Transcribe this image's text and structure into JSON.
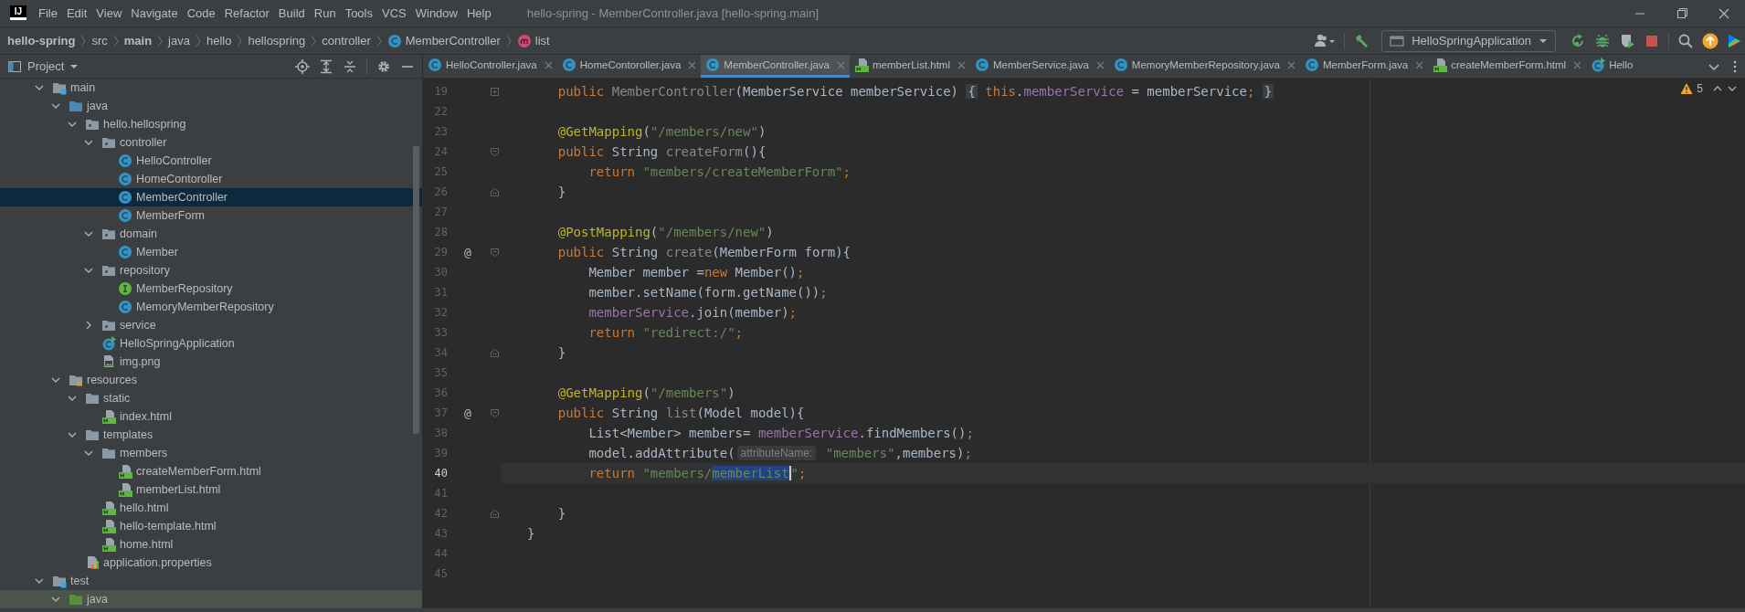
{
  "menu_bar": {
    "logo": "IJ",
    "items": [
      "File",
      "Edit",
      "View",
      "Navigate",
      "Code",
      "Refactor",
      "Build",
      "Run",
      "Tools",
      "VCS",
      "Window",
      "Help"
    ],
    "title": "hello-spring - MemberController.java [hello-spring.main]"
  },
  "navigation_bar": {
    "breadcrumbs": [
      {
        "label": "hello-spring",
        "bold": true
      },
      {
        "label": "src",
        "bold": false
      },
      {
        "label": "main",
        "bold": true
      },
      {
        "label": "java",
        "bold": false
      },
      {
        "label": "hello",
        "bold": false
      },
      {
        "label": "hellospring",
        "bold": false
      },
      {
        "label": "controller",
        "bold": false
      },
      {
        "label": "MemberController",
        "bold": false,
        "kind": "class"
      },
      {
        "label": "list",
        "bold": false,
        "kind": "method"
      }
    ],
    "run_configuration": "HelloSpringApplication"
  },
  "project_panel": {
    "title": "Project",
    "tree": [
      {
        "label": "main",
        "kind": "module",
        "expanded": true,
        "selected": false,
        "hovered": false,
        "children": [
          {
            "label": "java",
            "kind": "source-folder",
            "expanded": true,
            "selected": false,
            "hovered": false,
            "children": [
              {
                "label": "hello.hellospring",
                "kind": "package",
                "expanded": true,
                "selected": false,
                "hovered": false,
                "children": [
                  {
                    "label": "controller",
                    "kind": "package",
                    "expanded": true,
                    "selected": false,
                    "hovered": false,
                    "children": [
                      {
                        "label": "HelloController",
                        "kind": "class",
                        "selected": false,
                        "hovered": false
                      },
                      {
                        "label": "HomeContoroller",
                        "kind": "class",
                        "selected": false,
                        "hovered": false
                      },
                      {
                        "label": "MemberController",
                        "kind": "class",
                        "selected": true,
                        "hovered": false
                      },
                      {
                        "label": "MemberForm",
                        "kind": "class",
                        "selected": false,
                        "hovered": false
                      }
                    ]
                  },
                  {
                    "label": "domain",
                    "kind": "package",
                    "expanded": true,
                    "selected": false,
                    "hovered": false,
                    "children": [
                      {
                        "label": "Member",
                        "kind": "class",
                        "selected": false,
                        "hovered": false
                      }
                    ]
                  },
                  {
                    "label": "repository",
                    "kind": "package",
                    "expanded": true,
                    "selected": false,
                    "hovered": false,
                    "children": [
                      {
                        "label": "MemberRepository",
                        "kind": "interface",
                        "selected": false,
                        "hovered": false
                      },
                      {
                        "label": "MemoryMemberRepository",
                        "kind": "class",
                        "selected": false,
                        "hovered": false
                      }
                    ]
                  },
                  {
                    "label": "service",
                    "kind": "package",
                    "expanded": false,
                    "selected": false,
                    "hovered": false
                  },
                  {
                    "label": "HelloSpringApplication",
                    "kind": "spring-class",
                    "selected": false,
                    "hovered": false
                  },
                  {
                    "label": "img.png",
                    "kind": "image",
                    "selected": false,
                    "hovered": false
                  }
                ]
              }
            ]
          },
          {
            "label": "resources",
            "kind": "resources-folder",
            "expanded": true,
            "selected": false,
            "hovered": false,
            "children": [
              {
                "label": "static",
                "kind": "folder",
                "expanded": true,
                "selected": false,
                "hovered": false,
                "children": [
                  {
                    "label": "index.html",
                    "kind": "html",
                    "selected": false,
                    "hovered": false
                  }
                ]
              },
              {
                "label": "templates",
                "kind": "folder",
                "expanded": true,
                "selected": false,
                "hovered": false,
                "children": [
                  {
                    "label": "members",
                    "kind": "folder",
                    "expanded": true,
                    "selected": false,
                    "hovered": false,
                    "children": [
                      {
                        "label": "createMemberForm.html",
                        "kind": "html",
                        "selected": false,
                        "hovered": false
                      },
                      {
                        "label": "memberList.html",
                        "kind": "html",
                        "selected": false,
                        "hovered": false
                      }
                    ]
                  },
                  {
                    "label": "hello.html",
                    "kind": "html",
                    "selected": false,
                    "hovered": false
                  },
                  {
                    "label": "hello-template.html",
                    "kind": "html",
                    "selected": false,
                    "hovered": false
                  },
                  {
                    "label": "home.html",
                    "kind": "html",
                    "selected": false,
                    "hovered": false
                  }
                ]
              },
              {
                "label": "application.properties",
                "kind": "properties",
                "selected": false,
                "hovered": false
              }
            ]
          }
        ]
      },
      {
        "label": "test",
        "kind": "module",
        "expanded": true,
        "selected": false,
        "hovered": false,
        "children": [
          {
            "label": "java",
            "kind": "test-folder",
            "expanded": true,
            "selected": false,
            "hovered": true
          }
        ]
      }
    ]
  },
  "editor_tabs": [
    {
      "label": "HelloController.java",
      "kind": "class",
      "selected": false,
      "closable": true
    },
    {
      "label": "HomeContoroller.java",
      "kind": "class",
      "selected": false,
      "closable": true
    },
    {
      "label": "MemberController.java",
      "kind": "class",
      "selected": true,
      "closable": true
    },
    {
      "label": "memberList.html",
      "kind": "html",
      "selected": false,
      "closable": true
    },
    {
      "label": "MemberService.java",
      "kind": "class",
      "selected": false,
      "closable": true
    },
    {
      "label": "MemoryMemberRepository.java",
      "kind": "class",
      "selected": false,
      "closable": true
    },
    {
      "label": "MemberForm.java",
      "kind": "class",
      "selected": false,
      "closable": true
    },
    {
      "label": "createMemberForm.html",
      "kind": "html",
      "selected": false,
      "closable": true
    },
    {
      "label": "Hello",
      "kind": "spring-class",
      "selected": false,
      "closable": false
    }
  ],
  "editor": {
    "inspection_count": "5",
    "lines": [
      {
        "number": "19",
        "current": false,
        "kind": "folded",
        "tokens": [
          {
            "text": "    public ",
            "kind": "keyword"
          },
          {
            "text": "MemberController",
            "kind": "unused"
          },
          {
            "text": "(MemberService memberService) ",
            "kind": "plain"
          },
          {
            "text": "{",
            "kind": "folded"
          },
          {
            "text": " this",
            "kind": "keyword"
          },
          {
            "text": ".",
            "kind": "plain"
          },
          {
            "text": "memberService",
            "kind": "field"
          },
          {
            "text": " = memberService",
            "kind": "plain"
          },
          {
            "text": "; ",
            "kind": "keyword"
          },
          {
            "text": "}",
            "kind": "folded"
          }
        ]
      },
      {
        "number": "22",
        "current": false,
        "kind": "plain"
      },
      {
        "number": "23",
        "current": false,
        "kind": "plain",
        "tokens": [
          {
            "text": "    @GetMapping",
            "kind": "annotation"
          },
          {
            "text": "(",
            "kind": "plain"
          },
          {
            "text": "\"/members/new\"",
            "kind": "string"
          },
          {
            "text": ")",
            "kind": "plain"
          }
        ]
      },
      {
        "number": "24",
        "current": false,
        "kind": "fold-start",
        "tokens": [
          {
            "text": "    public",
            "kind": "keyword"
          },
          {
            "text": " String ",
            "kind": "plain"
          },
          {
            "text": "createForm",
            "kind": "unused"
          },
          {
            "text": "(){",
            "kind": "plain"
          }
        ]
      },
      {
        "number": "25",
        "current": false,
        "kind": "plain",
        "tokens": [
          {
            "text": "        return ",
            "kind": "keyword"
          },
          {
            "text": "\"members/createMemberForm\"",
            "kind": "string"
          },
          {
            "text": ";",
            "kind": "keyword"
          }
        ]
      },
      {
        "number": "26",
        "current": false,
        "kind": "fold-end",
        "tokens": [
          {
            "text": "    }",
            "kind": "plain"
          }
        ]
      },
      {
        "number": "27",
        "current": false,
        "kind": "plain"
      },
      {
        "number": "28",
        "current": false,
        "kind": "plain",
        "tokens": [
          {
            "text": "    @PostMapping",
            "kind": "annotation"
          },
          {
            "text": "(",
            "kind": "plain"
          },
          {
            "text": "\"/members/new\"",
            "kind": "string"
          },
          {
            "text": ")",
            "kind": "plain"
          }
        ]
      },
      {
        "number": "29",
        "current": false,
        "gutter_text": "@",
        "kind": "fold-start",
        "tokens": [
          {
            "text": "    public",
            "kind": "keyword"
          },
          {
            "text": " String ",
            "kind": "plain"
          },
          {
            "text": "create",
            "kind": "unused"
          },
          {
            "text": "(MemberForm form){",
            "kind": "plain"
          }
        ]
      },
      {
        "number": "30",
        "current": false,
        "kind": "plain",
        "tokens": [
          {
            "text": "        Member member =",
            "kind": "plain"
          },
          {
            "text": "new",
            "kind": "keyword"
          },
          {
            "text": " Member()",
            "kind": "plain"
          },
          {
            "text": ";",
            "kind": "keyword"
          }
        ]
      },
      {
        "number": "31",
        "current": false,
        "kind": "plain",
        "tokens": [
          {
            "text": "        member.setName(form.getName())",
            "kind": "plain"
          },
          {
            "text": ";",
            "kind": "keyword"
          }
        ]
      },
      {
        "number": "32",
        "current": false,
        "kind": "plain",
        "tokens": [
          {
            "text": "        memberService",
            "kind": "field"
          },
          {
            "text": ".join(member)",
            "kind": "plain"
          },
          {
            "text": ";",
            "kind": "keyword"
          }
        ]
      },
      {
        "number": "33",
        "current": false,
        "kind": "plain",
        "tokens": [
          {
            "text": "        return ",
            "kind": "keyword"
          },
          {
            "text": "\"redirect:/\"",
            "kind": "string"
          },
          {
            "text": ";",
            "kind": "keyword"
          }
        ]
      },
      {
        "number": "34",
        "current": false,
        "kind": "fold-end",
        "tokens": [
          {
            "text": "    }",
            "kind": "plain"
          }
        ]
      },
      {
        "number": "35",
        "current": false,
        "kind": "plain"
      },
      {
        "number": "36",
        "current": false,
        "kind": "plain",
        "tokens": [
          {
            "text": "    @GetMapping",
            "kind": "annotation"
          },
          {
            "text": "(",
            "kind": "plain"
          },
          {
            "text": "\"/members\"",
            "kind": "string"
          },
          {
            "text": ")",
            "kind": "plain"
          }
        ]
      },
      {
        "number": "37",
        "current": false,
        "gutter_text": "@",
        "kind": "fold-start",
        "tokens": [
          {
            "text": "    public",
            "kind": "keyword"
          },
          {
            "text": " String ",
            "kind": "plain"
          },
          {
            "text": "list",
            "kind": "unused"
          },
          {
            "text": "(Model model){",
            "kind": "plain"
          }
        ]
      },
      {
        "number": "38",
        "current": false,
        "kind": "plain",
        "tokens": [
          {
            "text": "        List<Member> members= ",
            "kind": "plain"
          },
          {
            "text": "memberService",
            "kind": "field"
          },
          {
            "text": ".findMembers()",
            "kind": "plain"
          },
          {
            "text": ";",
            "kind": "keyword"
          }
        ]
      },
      {
        "number": "39",
        "current": false,
        "kind": "plain",
        "tokens": [
          {
            "text": "        model.addAttribute(",
            "kind": "plain"
          },
          {
            "text": "attributeName:",
            "kind": "hint"
          },
          {
            "text": " \"members\"",
            "kind": "string"
          },
          {
            "text": ",members)",
            "kind": "plain"
          },
          {
            "text": ";",
            "kind": "keyword"
          }
        ]
      },
      {
        "number": "40",
        "current": true,
        "kind": "plain",
        "tokens": [
          {
            "text": "        return ",
            "kind": "keyword"
          },
          {
            "text": "\"members/",
            "kind": "string"
          },
          {
            "text": "memberList",
            "kind": "selection"
          },
          {
            "text": "\"",
            "kind": "string"
          },
          {
            "text": ";",
            "kind": "keyword"
          }
        ]
      },
      {
        "number": "41",
        "current": false,
        "kind": "plain"
      },
      {
        "number": "42",
        "current": false,
        "kind": "fold-end",
        "tokens": [
          {
            "text": "    }",
            "kind": "plain"
          }
        ]
      },
      {
        "number": "43",
        "current": false,
        "kind": "plain",
        "tokens": [
          {
            "text": "}",
            "kind": "plain"
          }
        ]
      },
      {
        "number": "44",
        "current": false,
        "kind": "plain"
      },
      {
        "number": "45",
        "current": false,
        "kind": "plain"
      }
    ]
  }
}
